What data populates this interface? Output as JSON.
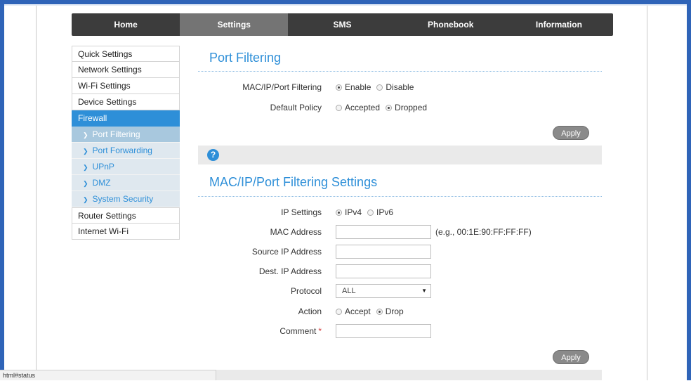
{
  "nav": {
    "items": [
      "Home",
      "Settings",
      "SMS",
      "Phonebook",
      "Information"
    ],
    "active_index": 1
  },
  "sidebar": {
    "items": [
      {
        "label": "Quick Settings"
      },
      {
        "label": "Network Settings"
      },
      {
        "label": "Wi-Fi Settings"
      },
      {
        "label": "Device Settings"
      },
      {
        "label": "Firewall"
      }
    ],
    "subitems": [
      {
        "label": "Port Filtering"
      },
      {
        "label": "Port Forwarding"
      },
      {
        "label": "UPnP"
      },
      {
        "label": "DMZ"
      },
      {
        "label": "System Security"
      }
    ],
    "bottom_items": [
      {
        "label": "Router Settings"
      },
      {
        "label": "Internet Wi-Fi"
      }
    ]
  },
  "port_filtering": {
    "title": "Port Filtering",
    "filter_label": "MAC/IP/Port Filtering",
    "filter_options": [
      "Enable",
      "Disable"
    ],
    "filter_selected": "Enable",
    "policy_label": "Default Policy",
    "policy_options": [
      "Accepted",
      "Dropped"
    ],
    "policy_selected": "Dropped",
    "apply_label": "Apply"
  },
  "help_icon_glyph": "?",
  "settings_section": {
    "title": "MAC/IP/Port Filtering Settings",
    "ip_label": "IP Settings",
    "ip_options": [
      "IPv4",
      "IPv6"
    ],
    "ip_selected": "IPv4",
    "mac_label": "MAC Address",
    "mac_value": "",
    "mac_hint": "(e.g., 00:1E:90:FF:FF:FF)",
    "source_ip_label": "Source IP Address",
    "source_ip_value": "",
    "dest_ip_label": "Dest. IP Address",
    "dest_ip_value": "",
    "protocol_label": "Protocol",
    "protocol_value": "ALL",
    "action_label": "Action",
    "action_options": [
      "Accept",
      "Drop"
    ],
    "action_selected": "Drop",
    "comment_label": "Comment",
    "comment_required": "*",
    "comment_value": "",
    "apply_label": "Apply"
  },
  "statusbar": {
    "text": "html#status"
  }
}
